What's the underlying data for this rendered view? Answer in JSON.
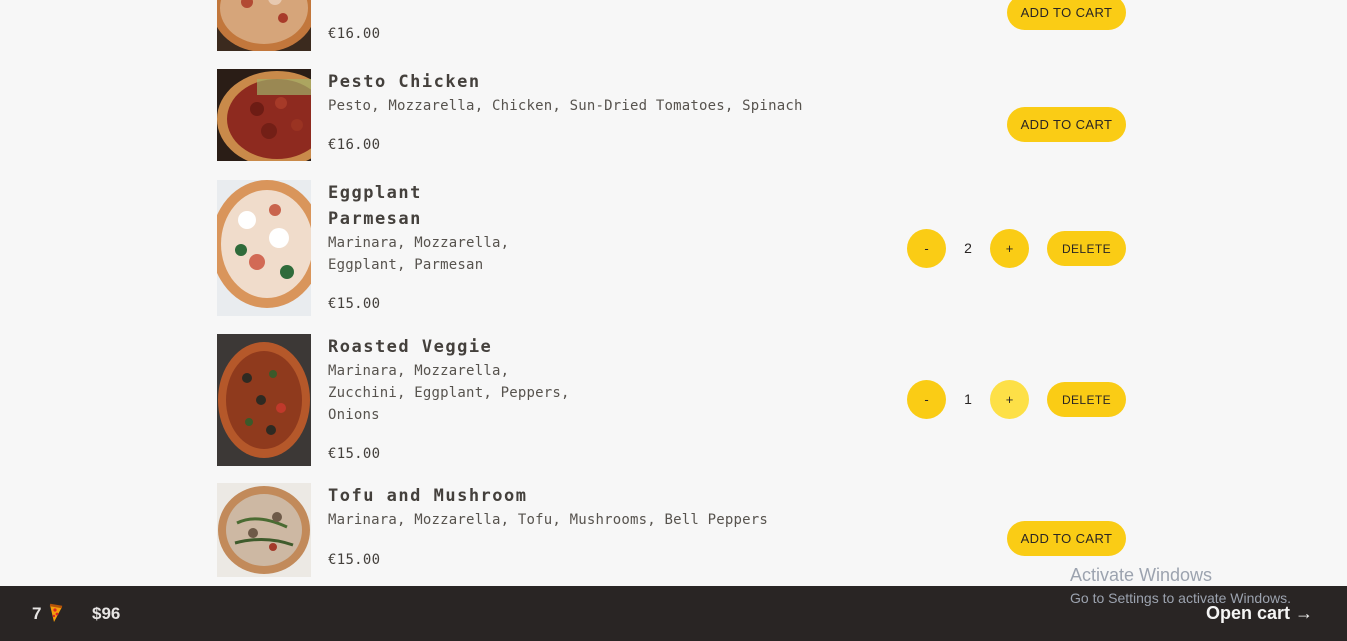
{
  "menu": {
    "items": [
      {
        "name": "",
        "ingredients": "",
        "price": "€16.00",
        "state": "add",
        "action_label": "ADD TO CART",
        "image_icon": "pizza-image"
      },
      {
        "name": "Pesto Chicken",
        "ingredients": "Pesto, Mozzarella, Chicken, Sun-Dried Tomatoes, Spinach",
        "price": "€16.00",
        "state": "add",
        "action_label": "ADD TO CART",
        "image_icon": "pizza-image"
      },
      {
        "name_line1": "Eggplant",
        "name_line2": "Parmesan",
        "ingredients_line1": "Marinara, Mozzarella,",
        "ingredients_line2": "Eggplant, Parmesan",
        "price": "€15.00",
        "state": "in-cart",
        "quantity": "2",
        "decrement_label": "-",
        "increment_label": "+",
        "delete_label": "DELETE",
        "image_icon": "pizza-image"
      },
      {
        "name": "Roasted Veggie",
        "ingredients_line1": "Marinara, Mozzarella,",
        "ingredients_line2": "Zucchini, Eggplant, Peppers,",
        "ingredients_line3": "Onions",
        "price": "€15.00",
        "state": "in-cart",
        "quantity": "1",
        "decrement_label": "-",
        "increment_label": "+",
        "delete_label": "DELETE",
        "image_icon": "pizza-image"
      },
      {
        "name": "Tofu and Mushroom",
        "ingredients": "Marinara, Mozzarella, Tofu, Mushrooms, Bell Peppers",
        "price": "€15.00",
        "state": "add",
        "action_label": "ADD TO CART",
        "image_icon": "pizza-image"
      }
    ]
  },
  "cart_bar": {
    "count": "7",
    "pizza_icon": "pizza-icon",
    "total": "$96",
    "open_label": "Open cart →"
  },
  "watermark": {
    "title": "Activate Windows",
    "subtitle": "Go to Settings to activate Windows."
  },
  "colors": {
    "accent": "#facc15",
    "accent_hover": "#fde047",
    "bar_bg": "#292524",
    "page_bg": "#f7f7f7",
    "text": "#44403c"
  }
}
